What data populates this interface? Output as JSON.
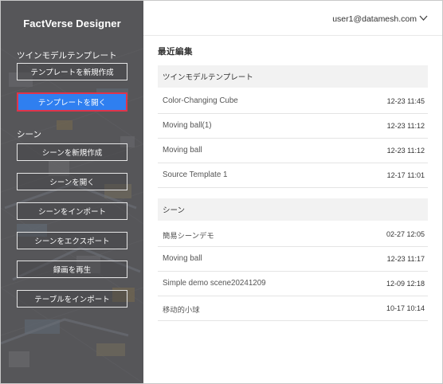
{
  "sidebar": {
    "brand": "FactVerse Designer",
    "template_section": "ツインモデルテンプレート",
    "template_buttons": [
      "テンプレートを新規作成",
      "テンプレートを開く"
    ],
    "scene_section": "シーン",
    "scene_buttons": [
      "シーンを新規作成",
      "シーンを開く",
      "シーンをインポート",
      "シーンをエクスポート",
      "録画を再生",
      "テーブルをインポート"
    ],
    "active_button": "テンプレートを開く",
    "active_color": "#2f7ff0",
    "active_border_color": "#e0344a"
  },
  "header": {
    "user": "user1@datamesh.com",
    "menu_icon": "chevron-down-icon"
  },
  "recent": {
    "title": "最近編集",
    "template_group": {
      "title": "ツインモデルテンプレート",
      "items": [
        {
          "name": "Color-Changing Cube",
          "time": "12-23 11:45"
        },
        {
          "name": "Moving ball(1)",
          "time": "12-23 11:12"
        },
        {
          "name": "Moving ball",
          "time": "12-23 11:12"
        },
        {
          "name": "Source Template 1",
          "time": "12-17 11:01"
        }
      ]
    },
    "scene_group": {
      "title": "シーン",
      "items": [
        {
          "name": "簡易シーンデモ",
          "time": "02-27 12:05"
        },
        {
          "name": "Moving ball",
          "time": "12-23 11:17"
        },
        {
          "name": "Simple demo scene20241209",
          "time": "12-09 12:18"
        },
        {
          "name": "移动的小球",
          "time": "10-17 10:14"
        }
      ]
    }
  }
}
